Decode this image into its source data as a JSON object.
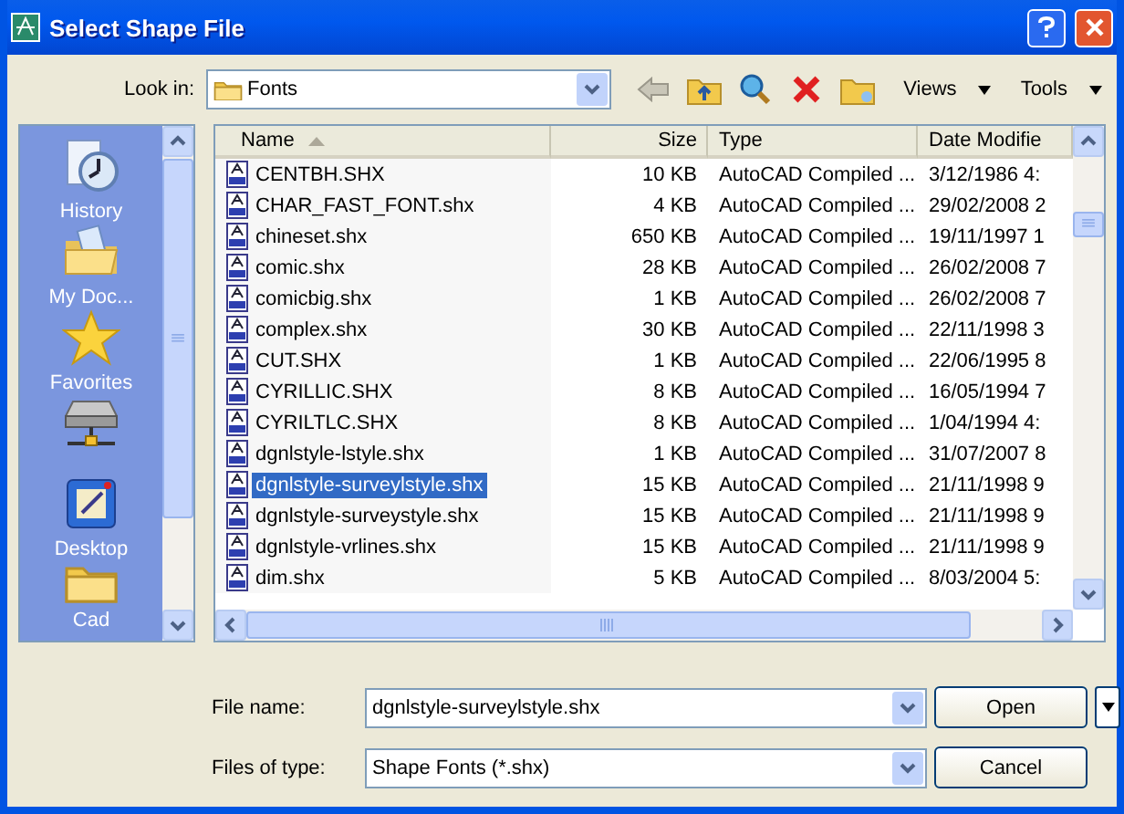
{
  "window": {
    "title": "Select Shape File"
  },
  "look_in": {
    "label": "Look in:",
    "value": "Fonts"
  },
  "toolbar": {
    "views": "Views",
    "tools": "Tools"
  },
  "places": [
    {
      "kind": "labeled",
      "label": "History"
    },
    {
      "kind": "labeled",
      "label": "My Doc..."
    },
    {
      "kind": "labeled",
      "label": "Favorites"
    },
    {
      "kind": "icon"
    },
    {
      "kind": "labeled",
      "label": "Desktop"
    },
    {
      "kind": "labeled",
      "label": "Cad"
    }
  ],
  "table": {
    "columns": [
      "Name",
      "Size",
      "Type",
      "Date Modifie"
    ],
    "rows": [
      {
        "cells": [
          "CENTBH.SHX",
          "10 KB",
          "AutoCAD Compiled ...",
          "3/12/1986 4:"
        ],
        "selected": false
      },
      {
        "cells": [
          "CHAR_FAST_FONT.shx",
          "4 KB",
          "AutoCAD Compiled ...",
          "29/02/2008 2"
        ],
        "selected": false
      },
      {
        "cells": [
          "chineset.shx",
          "650 KB",
          "AutoCAD Compiled ...",
          "19/11/1997 1"
        ],
        "selected": false
      },
      {
        "cells": [
          "comic.shx",
          "28 KB",
          "AutoCAD Compiled ...",
          "26/02/2008 7"
        ],
        "selected": false
      },
      {
        "cells": [
          "comicbig.shx",
          "1 KB",
          "AutoCAD Compiled ...",
          "26/02/2008 7"
        ],
        "selected": false
      },
      {
        "cells": [
          "complex.shx",
          "30 KB",
          "AutoCAD Compiled ...",
          "22/11/1998 3"
        ],
        "selected": false
      },
      {
        "cells": [
          "CUT.SHX",
          "1 KB",
          "AutoCAD Compiled ...",
          "22/06/1995 8"
        ],
        "selected": false
      },
      {
        "cells": [
          "CYRILLIC.SHX",
          "8 KB",
          "AutoCAD Compiled ...",
          "16/05/1994 7"
        ],
        "selected": false
      },
      {
        "cells": [
          "CYRILTLC.SHX",
          "8 KB",
          "AutoCAD Compiled ...",
          "1/04/1994 4:"
        ],
        "selected": false
      },
      {
        "cells": [
          "dgnlstyle-lstyle.shx",
          "1 KB",
          "AutoCAD Compiled ...",
          "31/07/2007 8"
        ],
        "selected": false
      },
      {
        "cells": [
          "dgnlstyle-surveylstyle.shx",
          "15 KB",
          "AutoCAD Compiled ...",
          "21/11/1998 9"
        ],
        "selected": true
      },
      {
        "cells": [
          "dgnlstyle-surveystyle.shx",
          "15 KB",
          "AutoCAD Compiled ...",
          "21/11/1998 9"
        ],
        "selected": false
      },
      {
        "cells": [
          "dgnlstyle-vrlines.shx",
          "15 KB",
          "AutoCAD Compiled ...",
          "21/11/1998 9"
        ],
        "selected": false
      },
      {
        "cells": [
          "dim.shx",
          "5 KB",
          "AutoCAD Compiled ...",
          "8/03/2004 5:"
        ],
        "selected": false
      }
    ]
  },
  "file_name": {
    "label": "File name:",
    "value": "dgnlstyle-surveylstyle.shx"
  },
  "file_type": {
    "label": "Files of type:",
    "value": "Shape Fonts (*.shx)"
  },
  "buttons": {
    "open": "Open",
    "cancel": "Cancel"
  }
}
